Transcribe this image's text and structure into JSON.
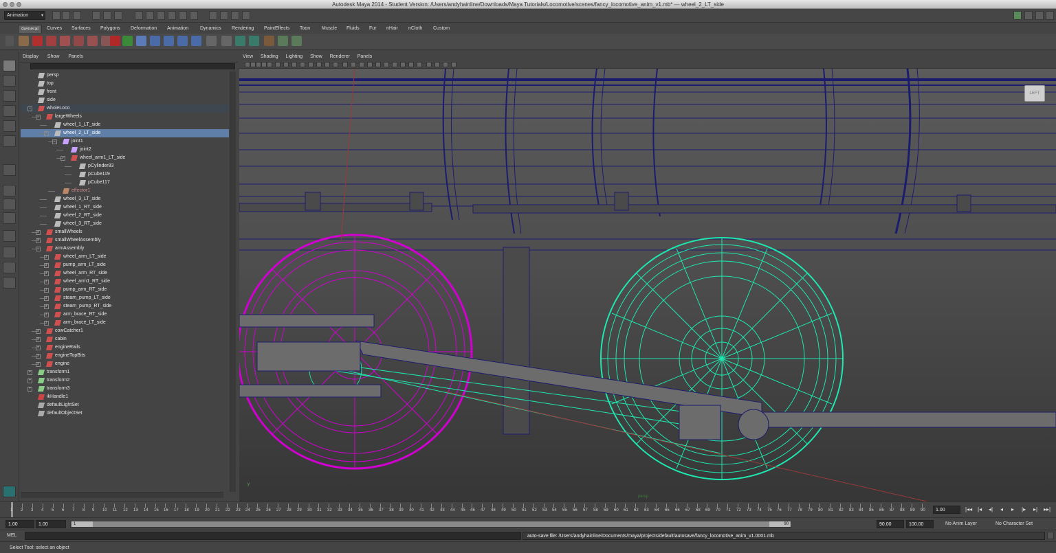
{
  "window": {
    "title": "Autodesk Maya 2014 - Student Version: /Users/andyhainline/Downloads/Maya Tutorials/Locomotive/scenes/fancy_locomotive_anim_v1.mb*   ---   wheel_2_LT_side"
  },
  "status_line": {
    "mode": "Animation"
  },
  "shelf": {
    "tabs": [
      "General",
      "Curves",
      "Surfaces",
      "Polygons",
      "Deformation",
      "Animation",
      "Dynamics",
      "Rendering",
      "PaintEffects",
      "Toon",
      "Muscle",
      "Fluids",
      "Fur",
      "nHair",
      "nCloth",
      "Custom"
    ],
    "active_tab": "General"
  },
  "outliner": {
    "menu": [
      "Display",
      "Show",
      "Panels"
    ],
    "items": [
      {
        "label": "persp",
        "depth": 0,
        "type": "camera"
      },
      {
        "label": "top",
        "depth": 0,
        "type": "camera"
      },
      {
        "label": "front",
        "depth": 0,
        "type": "camera"
      },
      {
        "label": "side",
        "depth": 0,
        "type": "camera"
      },
      {
        "label": "wholeLoco",
        "depth": 0,
        "type": "group",
        "expanded": true,
        "highlight": true
      },
      {
        "label": "largeWheels",
        "depth": 1,
        "type": "group",
        "expanded": true
      },
      {
        "label": "wheel_1_LT_side",
        "depth": 2,
        "type": "mesh"
      },
      {
        "label": "wheel_2_LT_side",
        "depth": 2,
        "type": "mesh",
        "expanded": true,
        "selected": true
      },
      {
        "label": "joint1",
        "depth": 3,
        "type": "joint",
        "expanded": true
      },
      {
        "label": "joint2",
        "depth": 4,
        "type": "joint"
      },
      {
        "label": "wheel_arm1_LT_side",
        "depth": 4,
        "type": "group",
        "expanded": true
      },
      {
        "label": "pCylinder83",
        "depth": 5,
        "type": "mesh"
      },
      {
        "label": "pCube119",
        "depth": 5,
        "type": "mesh"
      },
      {
        "label": "pCube117",
        "depth": 5,
        "type": "mesh"
      },
      {
        "label": "effector1",
        "depth": 3,
        "type": "effector",
        "dim": true
      },
      {
        "label": "wheel_3_LT_side",
        "depth": 2,
        "type": "mesh"
      },
      {
        "label": "wheel_1_RT_side",
        "depth": 2,
        "type": "mesh"
      },
      {
        "label": "wheel_2_RT_side",
        "depth": 2,
        "type": "mesh"
      },
      {
        "label": "wheel_3_RT_side",
        "depth": 2,
        "type": "mesh"
      },
      {
        "label": "smallWheels",
        "depth": 1,
        "type": "group"
      },
      {
        "label": "smallWheelAssembly",
        "depth": 1,
        "type": "group"
      },
      {
        "label": "armAssembly",
        "depth": 1,
        "type": "group",
        "expanded": true
      },
      {
        "label": "wheel_arm_LT_side",
        "depth": 2,
        "type": "group"
      },
      {
        "label": "pump_arm_LT_side",
        "depth": 2,
        "type": "group"
      },
      {
        "label": "wheel_arm_RT_side",
        "depth": 2,
        "type": "group"
      },
      {
        "label": "wheel_arm1_RT_side",
        "depth": 2,
        "type": "group"
      },
      {
        "label": "pump_arm_RT_side",
        "depth": 2,
        "type": "group"
      },
      {
        "label": "steam_pump_LT_side",
        "depth": 2,
        "type": "group"
      },
      {
        "label": "steam_pump_RT_side",
        "depth": 2,
        "type": "group"
      },
      {
        "label": "arm_brace_RT_side",
        "depth": 2,
        "type": "group"
      },
      {
        "label": "arm_brace_LT_side",
        "depth": 2,
        "type": "group"
      },
      {
        "label": "cowCatcher1",
        "depth": 1,
        "type": "group"
      },
      {
        "label": "cabin",
        "depth": 1,
        "type": "group"
      },
      {
        "label": "engineRails",
        "depth": 1,
        "type": "group"
      },
      {
        "label": "engineTopBits",
        "depth": 1,
        "type": "group"
      },
      {
        "label": "engine",
        "depth": 1,
        "type": "group"
      },
      {
        "label": "transform1",
        "depth": 0,
        "type": "transform"
      },
      {
        "label": "transform2",
        "depth": 0,
        "type": "transform"
      },
      {
        "label": "transform3",
        "depth": 0,
        "type": "transform"
      },
      {
        "label": "ikHandle1",
        "depth": 0,
        "type": "ik"
      },
      {
        "label": "defaultLightSet",
        "depth": 0,
        "type": "set"
      },
      {
        "label": "defaultObjectSet",
        "depth": 0,
        "type": "set"
      }
    ]
  },
  "viewport": {
    "menu": [
      "View",
      "Shading",
      "Lighting",
      "Show",
      "Renderer",
      "Panels"
    ],
    "viewcube_label": "LEFT",
    "camera_label": "persp"
  },
  "time_slider": {
    "ticks": [
      1,
      2,
      3,
      4,
      5,
      6,
      7,
      8,
      9,
      10,
      11,
      12,
      13,
      14,
      15,
      16,
      17,
      18,
      19,
      20,
      21,
      22,
      23,
      24,
      25,
      26,
      27,
      28,
      29,
      30,
      31,
      32,
      33,
      34,
      35,
      36,
      37,
      38,
      39,
      40,
      41,
      42,
      43,
      44,
      45,
      46,
      47,
      48,
      49,
      50,
      51,
      52,
      53,
      54,
      55,
      56,
      57,
      58,
      59,
      60,
      61,
      62,
      63,
      64,
      65,
      66,
      67,
      68,
      69,
      70,
      71,
      72,
      73,
      74,
      75,
      76,
      77,
      78,
      79,
      80,
      81,
      82,
      83,
      84,
      85,
      86,
      87,
      88,
      89,
      90
    ],
    "current_frame": "1.00"
  },
  "range_slider": {
    "start_time": "1.00",
    "playback_start": "1.00",
    "range_start_label": "1",
    "range_end_label": "90",
    "playback_end": "90.00",
    "end_time": "100.00",
    "anim_layer": "No Anim Layer",
    "character_set": "No Character Set"
  },
  "command_line": {
    "label": "MEL",
    "output": "auto-save file: /Users/andyhainline/Documents/maya/projects/default/autosave/fancy_locomotive_anim_v1.0001.mb"
  },
  "help_line": {
    "text": "Select Tool: select an object"
  },
  "colors": {
    "selection": "#5f7ea8",
    "magenta_wireframe": "#d000d0",
    "cyan_wireframe": "#1de8b0",
    "navy_wireframe": "#1c1c6e"
  }
}
